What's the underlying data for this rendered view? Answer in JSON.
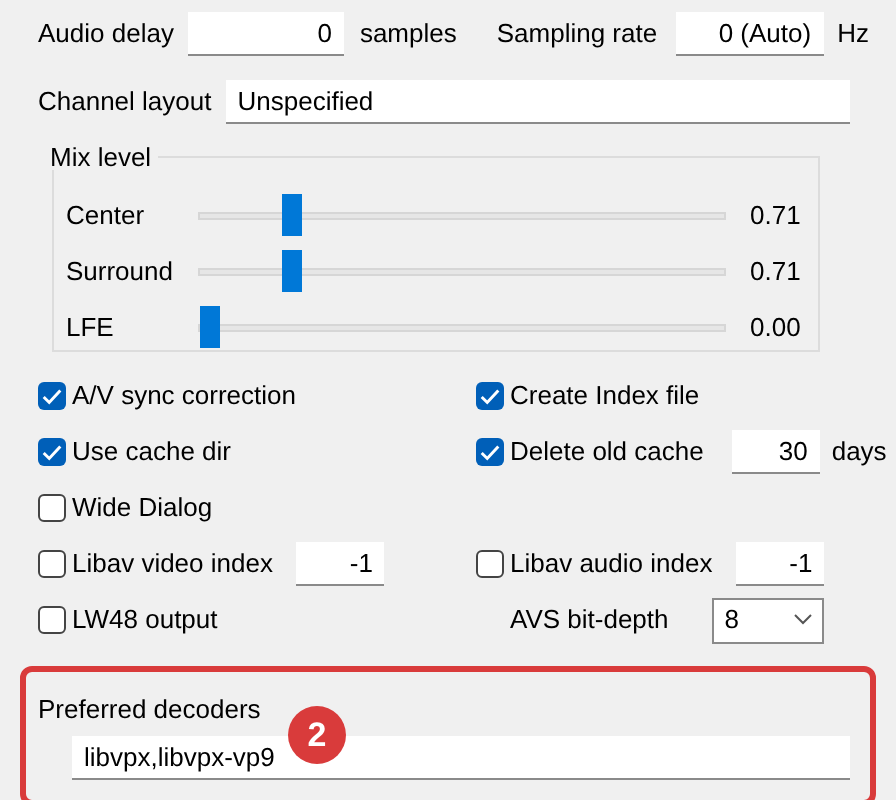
{
  "audio_delay": {
    "label": "Audio delay",
    "value": "0",
    "unit": "samples"
  },
  "sampling_rate": {
    "label": "Sampling rate",
    "value": "0 (Auto)",
    "unit": "Hz"
  },
  "channel_layout": {
    "label": "Channel layout",
    "value": "Unspecified"
  },
  "mix_level": {
    "title": "Mix level",
    "channels": [
      {
        "name": "Center",
        "level": 0.16,
        "reading": "0.71"
      },
      {
        "name": "Surround",
        "level": 0.16,
        "reading": "0.71"
      },
      {
        "name": "LFE",
        "level": 0,
        "reading": "0.00"
      }
    ]
  },
  "option_rows": [
    {
      "left": {
        "kind": "checkbox",
        "label": "A/V sync correction",
        "checked": true
      },
      "right": {
        "kind": "checkbox",
        "label": "Create Index file",
        "checked": true
      }
    },
    {
      "left": {
        "kind": "checkbox",
        "label": "Use cache dir",
        "checked": true
      },
      "right": {
        "kind": "checkbox",
        "label": "Delete old cache",
        "checked": true,
        "value": "30",
        "unit": "days"
      }
    },
    {
      "left": {
        "kind": "checkbox",
        "label": "Wide Dialog",
        "checked": false
      }
    },
    {
      "left": {
        "kind": "checkbox",
        "label": "Libav video index",
        "checked": false,
        "value": "-1"
      },
      "right": {
        "kind": "checkbox",
        "label": "Libav audio index",
        "checked": false,
        "value": "-1"
      }
    },
    {
      "left": {
        "kind": "checkbox",
        "label": "LW48 output",
        "checked": false
      },
      "right": {
        "kind": "select",
        "label": "AVS bit-depth",
        "value": "8"
      }
    }
  ],
  "preferred_decoders": {
    "label": "Preferred decoders",
    "value": "libvpx,libvpx-vp9",
    "badge": "2"
  }
}
